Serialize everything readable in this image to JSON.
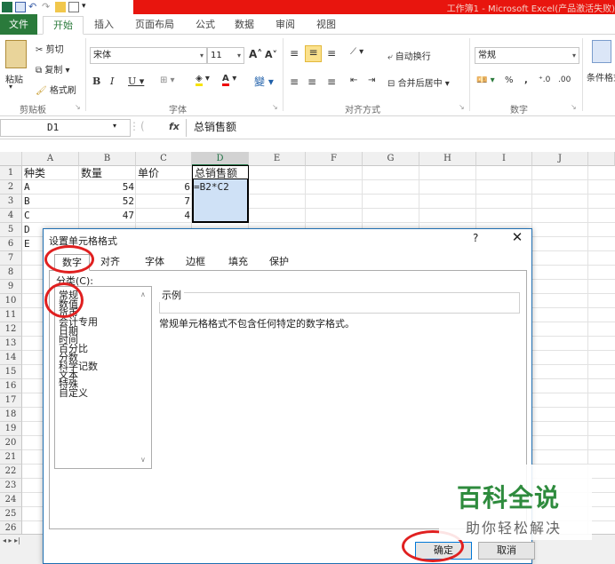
{
  "titlebar": {
    "title": "工作簿1 - Microsoft Excel(产品激活失败)"
  },
  "ribbon_tabs": [
    "文件",
    "开始",
    "插入",
    "页面布局",
    "公式",
    "数据",
    "审阅",
    "视图"
  ],
  "ribbon": {
    "paste": "粘贴",
    "cut": "剪切",
    "copy": "复制",
    "format_painter": "格式刷",
    "clipboard_group": "剪贴板",
    "font_name": "宋体",
    "font_size": "11",
    "font_group": "字体",
    "wrap_text": "自动换行",
    "merge_center": "合并后居中",
    "align_group": "对齐方式",
    "number_format": "常规",
    "number_group": "数字",
    "conditional_format": "条件格式"
  },
  "formula_bar": {
    "name_box": "D1",
    "fx": "fx",
    "content": "总销售额"
  },
  "columns": [
    "A",
    "B",
    "C",
    "D",
    "E",
    "F",
    "G",
    "H",
    "I",
    "J"
  ],
  "rows": [
    "1",
    "2",
    "3",
    "4",
    "5",
    "6",
    "7",
    "8",
    "9",
    "10",
    "11",
    "12",
    "13",
    "14",
    "15",
    "16",
    "17",
    "18",
    "19",
    "20",
    "21",
    "22",
    "23",
    "24",
    "25",
    "26"
  ],
  "cells": {
    "A1": "种类",
    "B1": "数量",
    "C1": "单价",
    "D1": "总销售额",
    "A2": "A",
    "B2": "54",
    "C2": "6",
    "D2": "=B2*C2",
    "A3": "B",
    "B3": "52",
    "C3": "7",
    "A4": "C",
    "B4": "47",
    "C4": "4",
    "A5": "D",
    "A6": "E"
  },
  "dialog": {
    "title": "设置单元格格式",
    "help": "?",
    "close": "✕",
    "tabs": [
      "数字",
      "对齐",
      "字体",
      "边框",
      "填充",
      "保护"
    ],
    "category_label": "分类(C):",
    "categories": [
      "常规",
      "数值",
      "货币",
      "会计专用",
      "日期",
      "时间",
      "百分比",
      "分数",
      "科学记数",
      "文本",
      "特殊",
      "自定义"
    ],
    "sample_label": "示例",
    "description": "常规单元格格式不包含任何特定的数字格式。",
    "ok": "确定",
    "cancel": "取消"
  },
  "watermark": {
    "title": "百科全说",
    "subtitle": "助你轻松解决"
  },
  "colors": {
    "file_tab": "#2a7a3b",
    "title_bar": "#e8150e",
    "highlight_circle": "#e02020",
    "selection_fill": "#cfe1f6",
    "watermark_green": "#2e8b3d"
  }
}
